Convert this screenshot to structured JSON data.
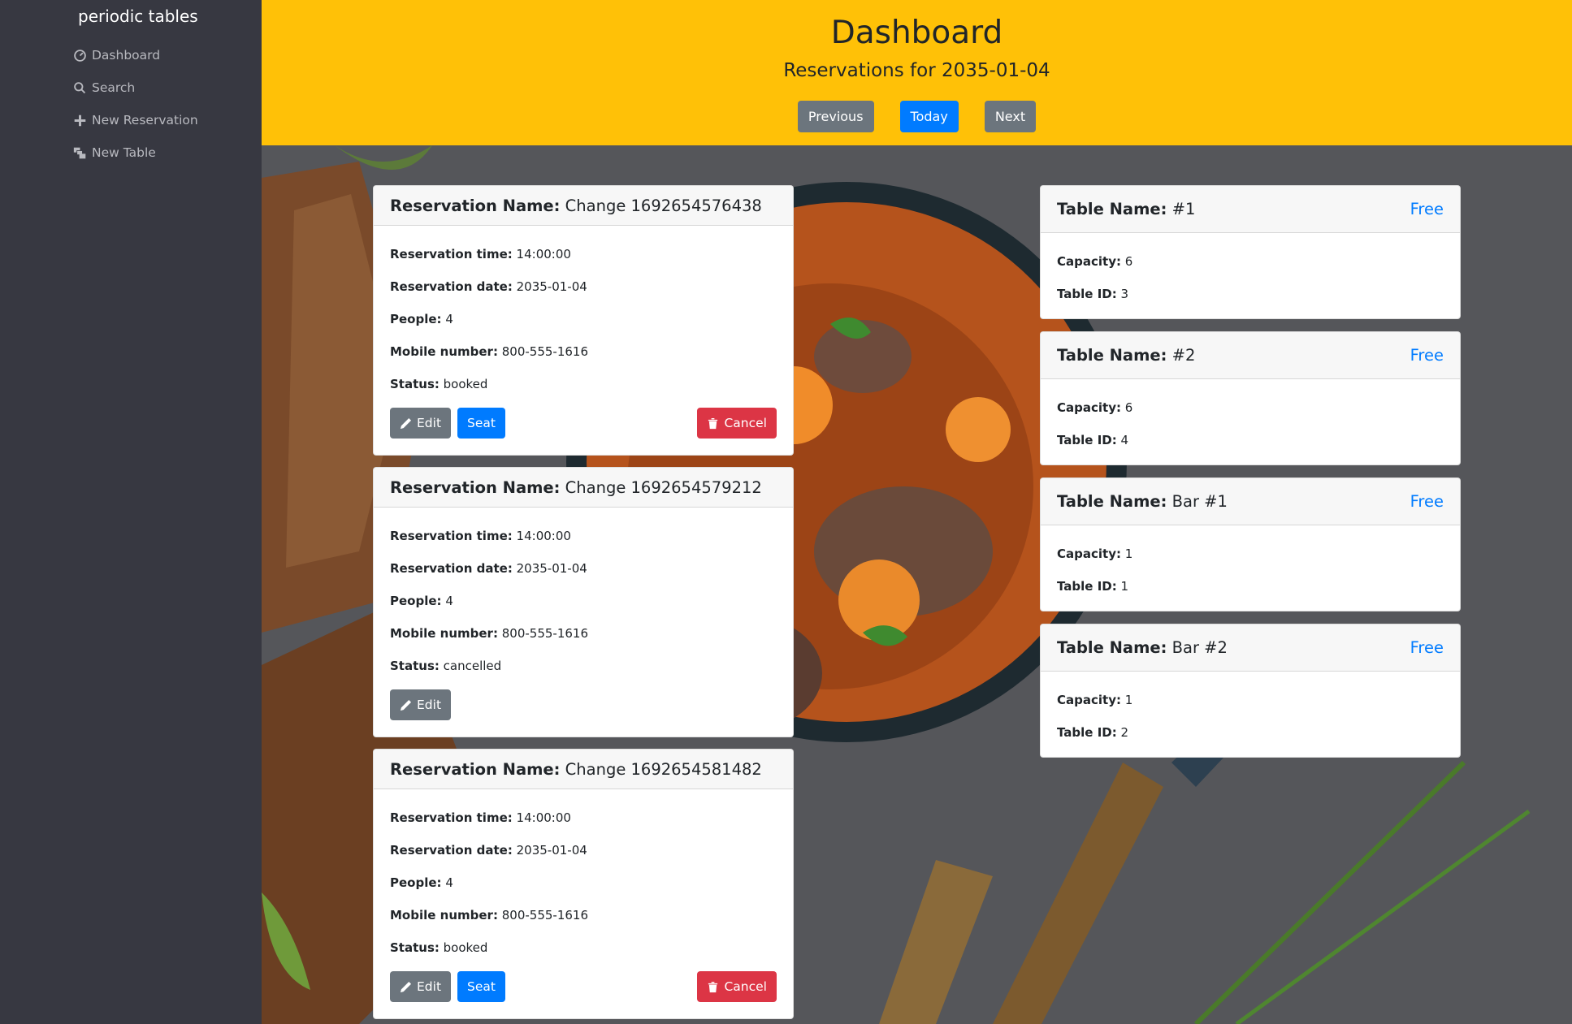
{
  "sidebar": {
    "brand": "periodic tables",
    "items": [
      {
        "label": "Dashboard",
        "icon": "dashboard-icon"
      },
      {
        "label": "Search",
        "icon": "search-icon"
      },
      {
        "label": "New Reservation",
        "icon": "plus-icon"
      },
      {
        "label": "New Table",
        "icon": "layers-icon"
      }
    ]
  },
  "header": {
    "title": "Dashboard",
    "subtitle": "Reservations for 2035-01-04",
    "previous": "Previous",
    "today": "Today",
    "next": "Next",
    "color": "#ffc107"
  },
  "labels": {
    "reservation_name": "Reservation Name:",
    "reservation_time": "Reservation time:",
    "reservation_date": "Reservation date:",
    "people": "People:",
    "mobile": "Mobile number:",
    "status": "Status:",
    "edit": "Edit",
    "seat": "Seat",
    "cancel": "Cancel",
    "table_name": "Table Name:",
    "capacity": "Capacity:",
    "table_id": "Table ID:"
  },
  "reservations": [
    {
      "name": "Change 1692654576438",
      "time": "14:00:00",
      "date": "2035-01-04",
      "people": "4",
      "mobile": "800-555-1616",
      "status": "booked"
    },
    {
      "name": "Change 1692654579212",
      "time": "14:00:00",
      "date": "2035-01-04",
      "people": "4",
      "mobile": "800-555-1616",
      "status": "cancelled"
    },
    {
      "name": "Change 1692654581482",
      "time": "14:00:00",
      "date": "2035-01-04",
      "people": "4",
      "mobile": "800-555-1616",
      "status": "booked"
    }
  ],
  "tables": [
    {
      "name": "#1",
      "status": "Free",
      "capacity": "6",
      "id": "3"
    },
    {
      "name": "#2",
      "status": "Free",
      "capacity": "6",
      "id": "4"
    },
    {
      "name": "Bar #1",
      "status": "Free",
      "capacity": "1",
      "id": "1"
    },
    {
      "name": "Bar #2",
      "status": "Free",
      "capacity": "1",
      "id": "2"
    }
  ]
}
